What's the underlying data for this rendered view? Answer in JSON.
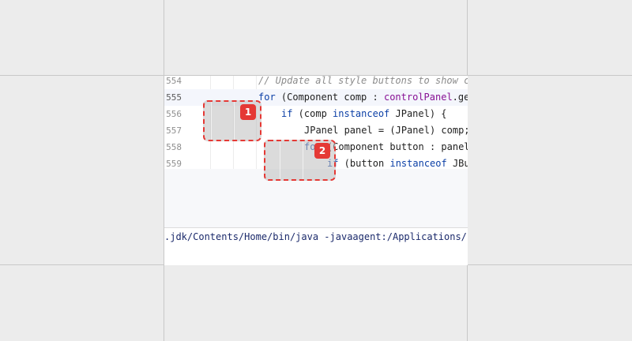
{
  "editor": {
    "lines": [
      {
        "number": "554",
        "comment": "// Update all style buttons to show c"
      },
      {
        "number": "555",
        "kw": "for",
        "a": " (Component comp : ",
        "field": "controlPanel",
        "b": ".ge"
      },
      {
        "number": "556",
        "kw": "if",
        "a": " (comp ",
        "kw2": "instanceof",
        "b": " JPanel) {"
      },
      {
        "number": "557",
        "text": "JPanel panel = (JPanel) comp;"
      },
      {
        "number": "558",
        "kw": "for",
        "a": " (Component button : panel"
      },
      {
        "number": "559",
        "kw": "if",
        "a": " (button ",
        "kw2": "instanceof",
        "b": " JBu"
      }
    ]
  },
  "console": {
    "command": ".jdk/Contents/Home/bin/java -javaagent:/Applications/I"
  },
  "highlights": [
    {
      "label": "1"
    },
    {
      "label": "2"
    }
  ]
}
